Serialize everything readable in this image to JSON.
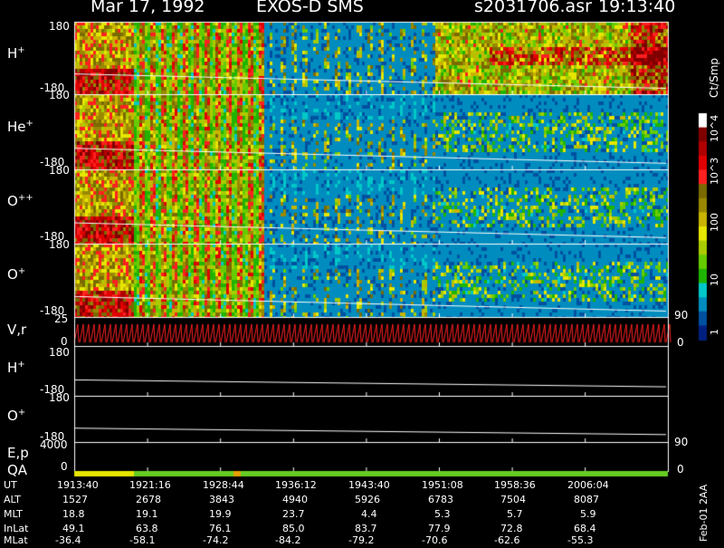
{
  "header": {
    "date": "Mar 17, 1992",
    "instrument": "EXOS-D SMS",
    "file": "s2031706.asr",
    "time": "19:13:40"
  },
  "panel_labels": [
    "H",
    "He",
    "O",
    "O",
    "V,r",
    "H",
    "O",
    "E,p",
    "QA"
  ],
  "panel_sups": [
    "+",
    "+",
    "++",
    "+",
    "",
    "+",
    "+",
    "",
    ""
  ],
  "axis_labels": {
    "top": "180",
    "bottom": "-180",
    "vr_top": "25",
    "vr_zero": "0",
    "vr_right_top": "90",
    "vr_right_zero": "0",
    "ep_top": "4000",
    "ep_zero": "0",
    "ep_right_top": "90",
    "ep_right_zero": "0"
  },
  "colorbar": {
    "unit": "Ct/Smp",
    "tick_labels": [
      "10^4",
      "10^3",
      "100",
      "10",
      "1"
    ],
    "colors": [
      "#ffffff",
      "#800000",
      "#b00000",
      "#e00000",
      "#ff2020",
      "#7a6a00",
      "#9a8800",
      "#c8b400",
      "#e6e600",
      "#aacc00",
      "#66cc00",
      "#1fb400",
      "#00c8c8",
      "#008cbe",
      "#0050a0",
      "#002080"
    ]
  },
  "stamp": "Feb-01 2AA",
  "ticks": {
    "ut": [
      "1913:40",
      "1921:16",
      "1928:44",
      "1936:12",
      "1943:40",
      "1951:08",
      "1958:36",
      "2006:04"
    ],
    "alt": [
      "1527",
      "2678",
      "3843",
      "4940",
      "5926",
      "6783",
      "7504",
      "8087"
    ],
    "mlt": [
      "18.8",
      "19.1",
      "19.9",
      "23.7",
      "4.4",
      "5.3",
      "5.7",
      "5.9"
    ],
    "inlat": [
      "49.1",
      "63.8",
      "76.1",
      "85.0",
      "83.7",
      "77.9",
      "72.8",
      "68.4"
    ],
    "mlat": [
      "-36.4",
      "-58.1",
      "-74.2",
      "-84.2",
      "-79.2",
      "-70.6",
      "-62.6",
      "-55.3"
    ]
  },
  "row_labels": [
    "UT",
    "ALT",
    "MLT",
    "InLat",
    "MLat"
  ],
  "chart_data": [
    {
      "type": "heatmap",
      "series": [
        {
          "name": "H+"
        }
      ],
      "ylim": [
        -180,
        180
      ]
    },
    {
      "type": "heatmap",
      "series": [
        {
          "name": "He+"
        }
      ],
      "ylim": [
        -180,
        180
      ]
    },
    {
      "type": "heatmap",
      "series": [
        {
          "name": "O++"
        }
      ],
      "ylim": [
        -180,
        180
      ]
    },
    {
      "type": "heatmap",
      "series": [
        {
          "name": "O+"
        }
      ],
      "ylim": [
        -180,
        180
      ]
    },
    {
      "type": "line",
      "series": [
        {
          "name": "V,r"
        }
      ],
      "ylim": [
        0,
        25
      ]
    },
    {
      "type": "line",
      "series": [
        {
          "name": "H+"
        }
      ],
      "ylim": [
        -180,
        180
      ]
    },
    {
      "type": "line",
      "series": [
        {
          "name": "O+"
        }
      ],
      "ylim": [
        -180,
        180
      ]
    },
    {
      "type": "line",
      "series": [
        {
          "name": "E,p"
        }
      ],
      "ylim": [
        0,
        4000
      ]
    }
  ]
}
